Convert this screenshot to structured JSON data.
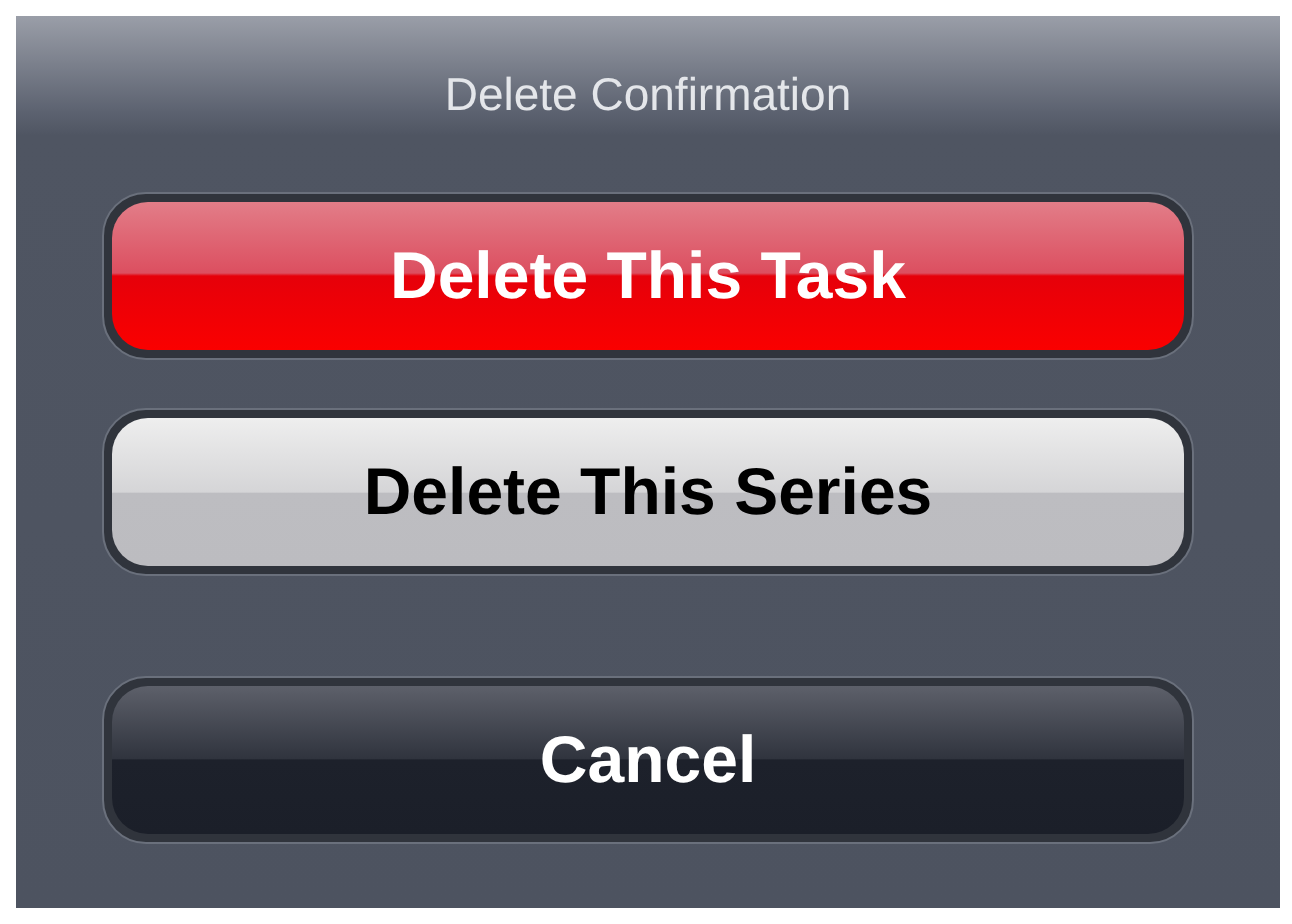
{
  "action_sheet": {
    "title": "Delete Confirmation",
    "buttons": [
      {
        "label": "Delete This Task",
        "kind": "destructive"
      },
      {
        "label": "Delete This Series",
        "kind": "default"
      },
      {
        "label": "Cancel",
        "kind": "cancel"
      }
    ]
  }
}
